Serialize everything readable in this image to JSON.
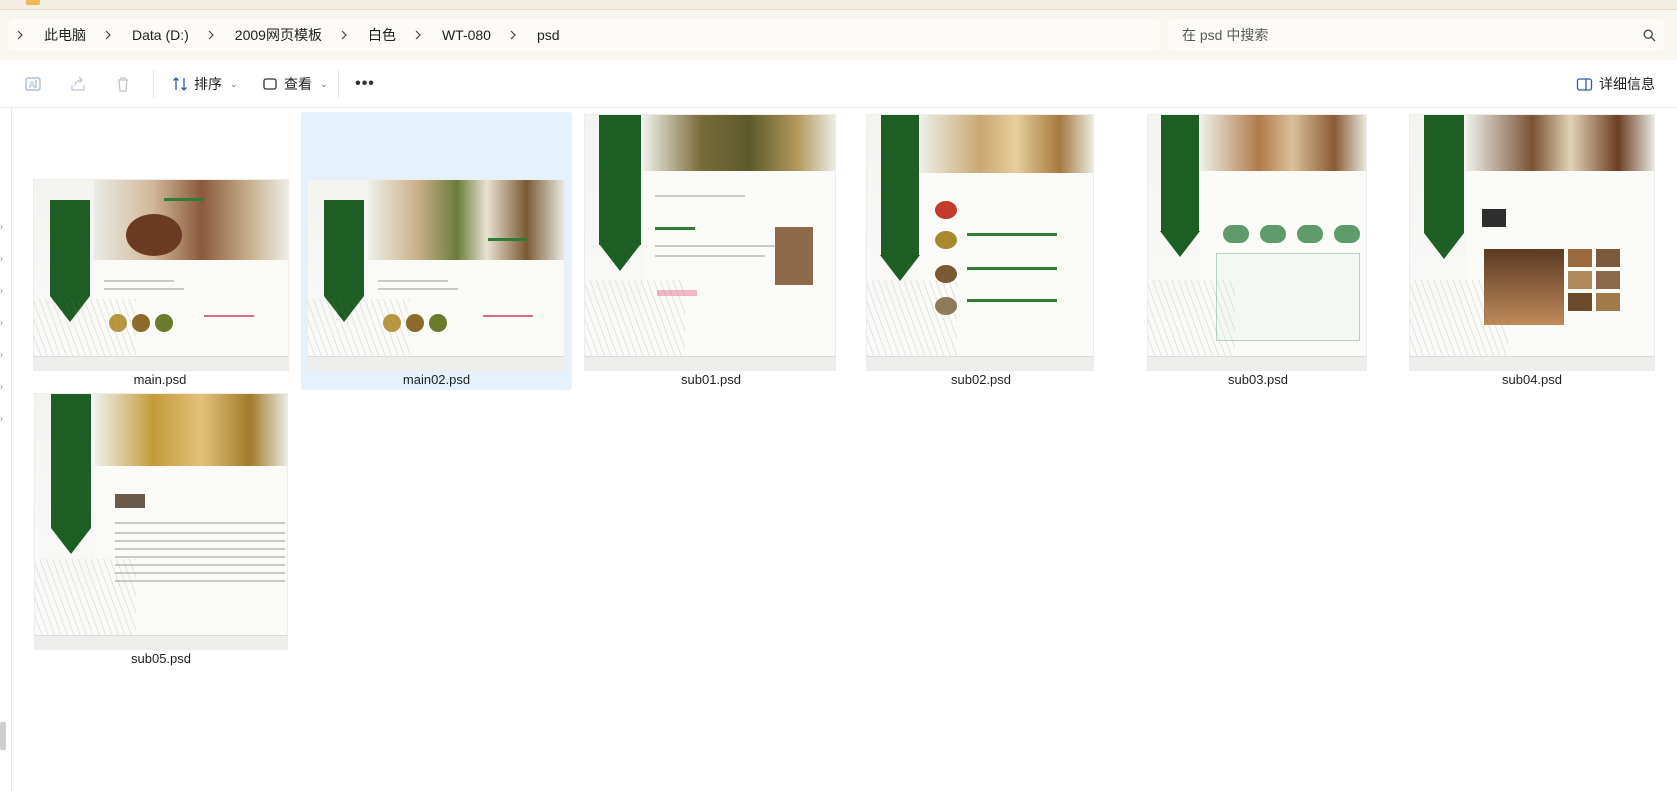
{
  "breadcrumb": {
    "items": [
      "此电脑",
      "Data (D:)",
      "2009网页模板",
      "白色",
      "WT-080",
      "psd"
    ]
  },
  "search": {
    "placeholder": "在 psd 中搜索"
  },
  "toolbar": {
    "rename_icon": "rename-icon",
    "share_icon": "share-icon",
    "delete_icon": "trash-icon",
    "sort_label": "排序",
    "view_label": "查看",
    "more_label": "•••",
    "details_label": "详细信息"
  },
  "files": [
    {
      "name": "main.psd",
      "selected": false,
      "hero": "steak"
    },
    {
      "name": "main02.psd",
      "selected": true,
      "hero": "namul"
    },
    {
      "name": "sub01.psd",
      "selected": false,
      "hero": "namul"
    },
    {
      "name": "sub02.psd",
      "selected": false,
      "hero": "soup"
    },
    {
      "name": "sub03.psd",
      "selected": false,
      "hero": "noodle"
    },
    {
      "name": "sub04.psd",
      "selected": false,
      "hero": "tea"
    },
    {
      "name": "sub05.psd",
      "selected": false,
      "hero": "brass"
    }
  ],
  "colors": {
    "accent_green": "#1d5e24",
    "selection": "#e5f1fb"
  }
}
